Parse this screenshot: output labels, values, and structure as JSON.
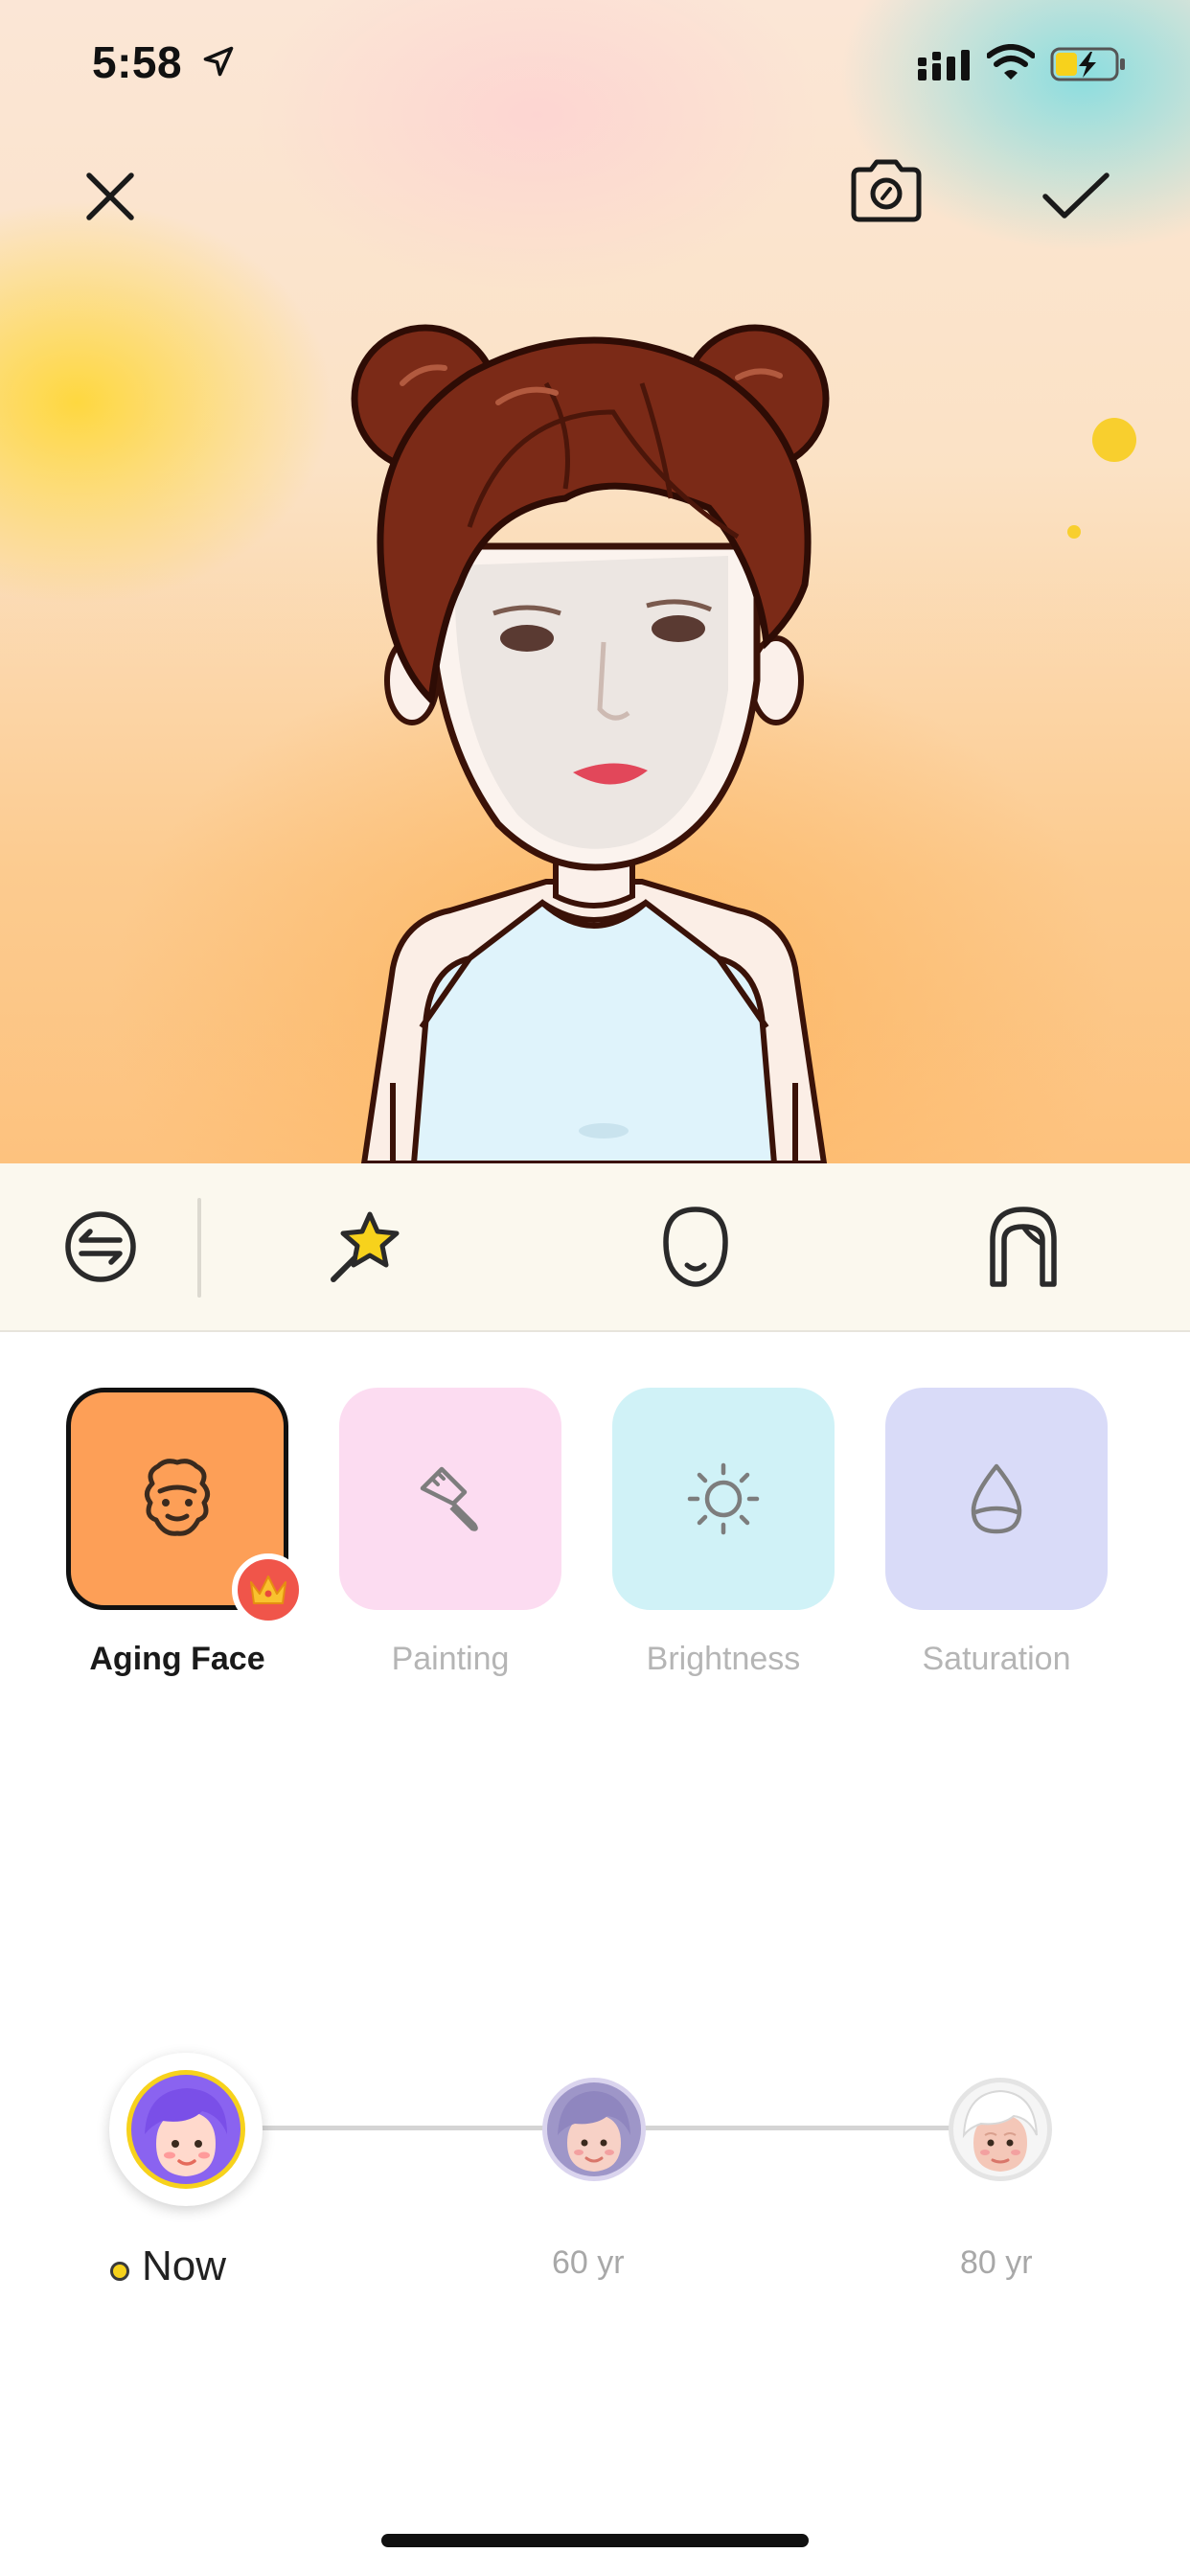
{
  "status_bar": {
    "time": "5:58",
    "location_icon": "location-arrow-icon",
    "signal_icon": "cellular-signal-icon",
    "wifi_icon": "wifi-icon",
    "battery_icon": "battery-charging-icon",
    "battery_color": "#f7d21c"
  },
  "top_bar": {
    "close_icon": "close-icon",
    "camera_icon": "camera-switch-icon",
    "confirm_icon": "checkmark-icon"
  },
  "toolbar": {
    "items": [
      {
        "icon": "swap-icon",
        "selected": false
      },
      {
        "icon": "magic-wand-star-icon",
        "selected": true
      },
      {
        "icon": "face-shape-icon",
        "selected": false
      },
      {
        "icon": "hair-icon",
        "selected": false
      }
    ]
  },
  "effects": [
    {
      "label": "Aging Face",
      "icon": "aging-face-icon",
      "color": "#fd9f57",
      "selected": true,
      "badge": "crown-icon"
    },
    {
      "label": "Painting",
      "icon": "paint-brush-icon",
      "color": "#fcdcf1",
      "selected": false
    },
    {
      "label": "Brightness",
      "icon": "sun-icon",
      "color": "#d0f2f7",
      "selected": false
    },
    {
      "label": "Saturation",
      "icon": "drop-icon",
      "color": "#d9dbf8",
      "selected": false
    }
  ],
  "age_slider": {
    "stops": [
      {
        "label": "Now",
        "active": true
      },
      {
        "label": "60 yr",
        "active": false
      },
      {
        "label": "80 yr",
        "active": false
      }
    ],
    "active_color": "#f7d21c"
  }
}
